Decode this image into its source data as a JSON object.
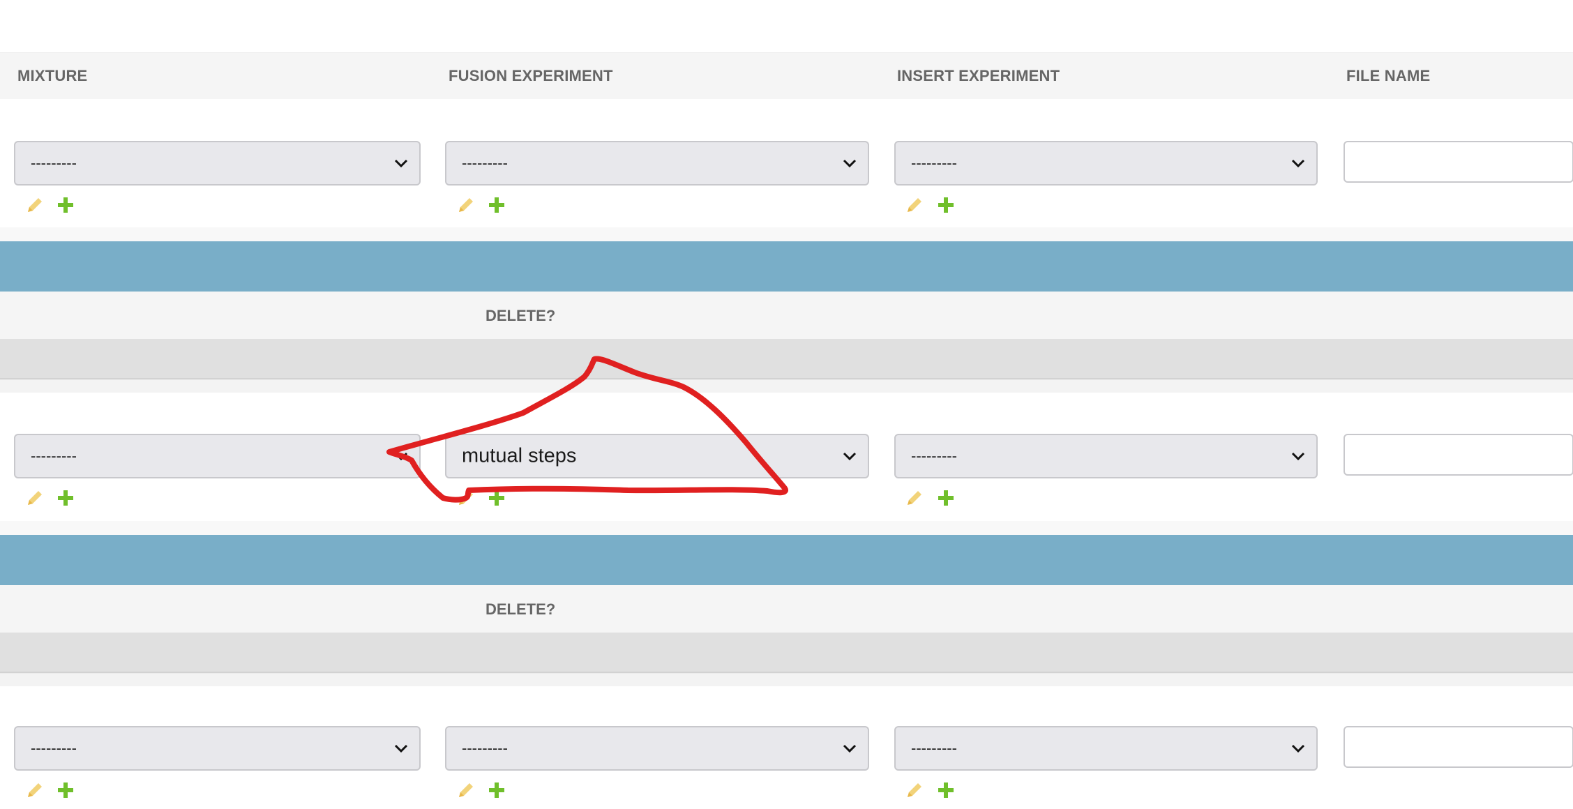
{
  "headers": {
    "mixture": "MIXTURE",
    "fusion_experiment": "FUSION EXPERIMENT",
    "insert_experiment": "INSERT EXPERIMENT",
    "file_name": "FILE NAME"
  },
  "delete_label": "DELETE?",
  "rows": [
    {
      "mixture": "---------",
      "fusion_experiment": "---------",
      "insert_experiment": "---------",
      "file_name": ""
    },
    {
      "mixture": "---------",
      "fusion_experiment": "mutual steps",
      "insert_experiment": "---------",
      "file_name": ""
    },
    {
      "mixture": "---------",
      "fusion_experiment": "---------",
      "insert_experiment": "---------",
      "file_name": ""
    }
  ],
  "icons": {
    "edit": "pencil-icon",
    "add": "plus-icon",
    "dropdown": "chevron-down-icon"
  },
  "colors": {
    "header_text": "#666666",
    "blue_bar": "#79aec8",
    "edit_icon": "#f2d37a",
    "add_icon": "#70bf2b",
    "annotation": "#e02020"
  }
}
